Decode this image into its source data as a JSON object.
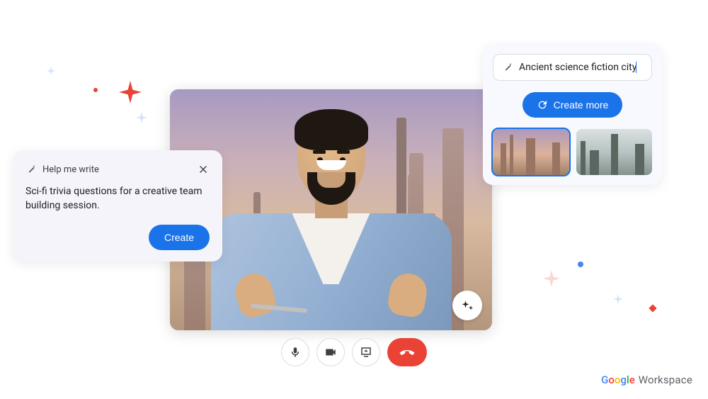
{
  "help_me_write": {
    "title": "Help me write",
    "prompt": "Sci-fi trivia questions for a creative team building session.",
    "create_label": "Create"
  },
  "background_generator": {
    "prompt_value": "Ancient science fiction city",
    "create_more_label": "Create more",
    "thumbnails": [
      {
        "alt": "warm-toned sci-fi city",
        "selected": true
      },
      {
        "alt": "cool-toned sci-fi city",
        "selected": false
      }
    ]
  },
  "meeting_controls": {
    "mic": "microphone",
    "camera": "camera",
    "present": "present-screen",
    "hangup": "end-call"
  },
  "branding": {
    "google": "Google",
    "workspace": "Workspace"
  },
  "colors": {
    "accent_blue": "#1a73e8",
    "hangup_red": "#ea4335"
  }
}
